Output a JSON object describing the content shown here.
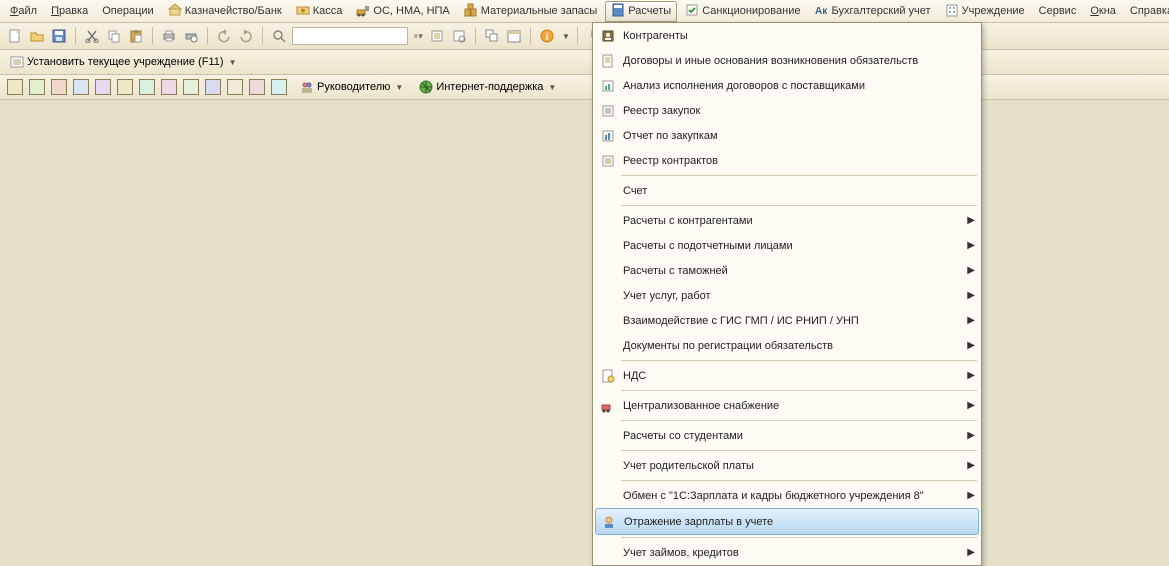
{
  "menubar": {
    "items": [
      {
        "label": "Файл",
        "underline": "Ф"
      },
      {
        "label": "Правка",
        "underline": "П"
      },
      {
        "label": "Операции"
      },
      {
        "label": "Казначейство/Банк",
        "icon": "bank"
      },
      {
        "label": "Касса",
        "icon": "cash"
      },
      {
        "label": "ОС, НМА, НПА",
        "icon": "assets"
      },
      {
        "label": "Материальные запасы",
        "icon": "stock"
      },
      {
        "label": "Расчеты",
        "icon": "calc",
        "active": true
      },
      {
        "label": "Санкционирование",
        "icon": "sanction"
      },
      {
        "label": "Бухгалтерский учет",
        "icon": "ledger"
      },
      {
        "label": "Учреждение",
        "icon": "org"
      },
      {
        "label": "Сервис"
      },
      {
        "label": "Окна",
        "underline": "О"
      },
      {
        "label": "Справка"
      }
    ]
  },
  "toolbar1": {
    "search_value": ""
  },
  "toolbar2": {
    "set_org_label": "Установить текущее учреждение (F11)"
  },
  "toolbar3": {
    "manager_label": "Руководителю",
    "support_label": "Интернет-поддержка"
  },
  "dropdown": {
    "items": [
      {
        "label": "Контрагенты",
        "icon": "contacts"
      },
      {
        "label": "Договоры и иные основания возникновения обязательств",
        "icon": "doc"
      },
      {
        "label": "Анализ исполнения договоров с поставщиками",
        "icon": "report"
      },
      {
        "label": "Реестр закупок",
        "icon": "list"
      },
      {
        "label": "Отчет по закупкам",
        "icon": "report2"
      },
      {
        "label": "Реестр контрактов",
        "icon": "list2"
      },
      {
        "sep": true
      },
      {
        "label": "Счет"
      },
      {
        "sep": true
      },
      {
        "label": "Расчеты с контрагентами",
        "submenu": true
      },
      {
        "label": "Расчеты с подотчетными лицами",
        "submenu": true
      },
      {
        "label": "Расчеты с таможней",
        "submenu": true
      },
      {
        "label": "Учет услуг, работ",
        "submenu": true
      },
      {
        "label": "Взаимодействие с ГИС ГМП / ИС РНИП / УНП",
        "submenu": true
      },
      {
        "label": "Документы по регистрации обязательств",
        "submenu": true
      },
      {
        "sep": true
      },
      {
        "label": "НДС",
        "icon": "nds",
        "submenu": true
      },
      {
        "sep": true
      },
      {
        "label": "Централизованное снабжение",
        "icon": "supply",
        "submenu": true
      },
      {
        "sep": true
      },
      {
        "label": "Расчеты со студентами",
        "submenu": true
      },
      {
        "sep": true
      },
      {
        "label": "Учет родительской платы",
        "submenu": true
      },
      {
        "sep": true
      },
      {
        "label": "Обмен с \"1С:Зарплата и кадры бюджетного учреждения 8\"",
        "submenu": true
      },
      {
        "label": "Отражение зарплаты в учете",
        "icon": "person",
        "highlight": true
      },
      {
        "sep": true
      },
      {
        "label": "Учет займов, кредитов",
        "submenu": true
      }
    ]
  }
}
